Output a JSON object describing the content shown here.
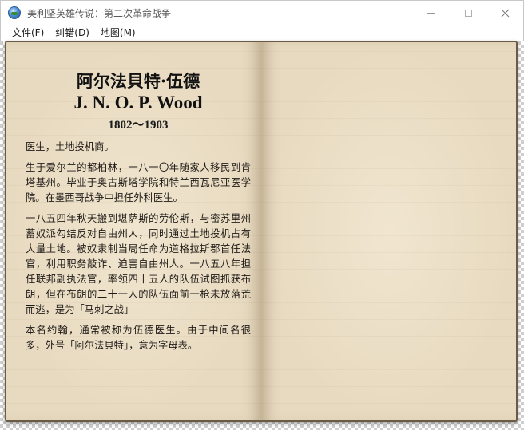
{
  "window": {
    "title": "美利坚英雄传说：第二次革命战争"
  },
  "menu": {
    "items": [
      {
        "label": "文件(F)"
      },
      {
        "label": "纠错(D)"
      },
      {
        "label": "地图(M)"
      }
    ]
  },
  "page": {
    "name_cn": "阿尔法貝特·伍德",
    "name_en": "J. N. O. P. Wood",
    "years": "1802～1903",
    "paragraphs": [
      "医生，土地投机商。",
      "生于爱尔兰的都柏林，一八一〇年随家人移民到肯塔基州。毕业于奥古斯塔学院和特兰西瓦尼亚医学院。在墨西哥战争中担任外科医生。",
      "一八五四年秋天搬到堪萨斯的劳伦斯，与密苏里州蓄奴派勾结反对自由州人，同时通过土地投机占有大量土地。被奴隶制当局任命为道格拉斯郡首任法官，利用职务敲诈、迫害自由州人。一八五八年担任联邦副执法官，率领四十五人的队伍试图抓获布朗，但在布朗的二十一人的队伍面前一枪未放落荒而逃，是为「马刺之战」",
      "本名约翰，通常被称为伍德医生。由于中间名很多，外号「阿尔法貝特」，意为字母表。"
    ]
  }
}
